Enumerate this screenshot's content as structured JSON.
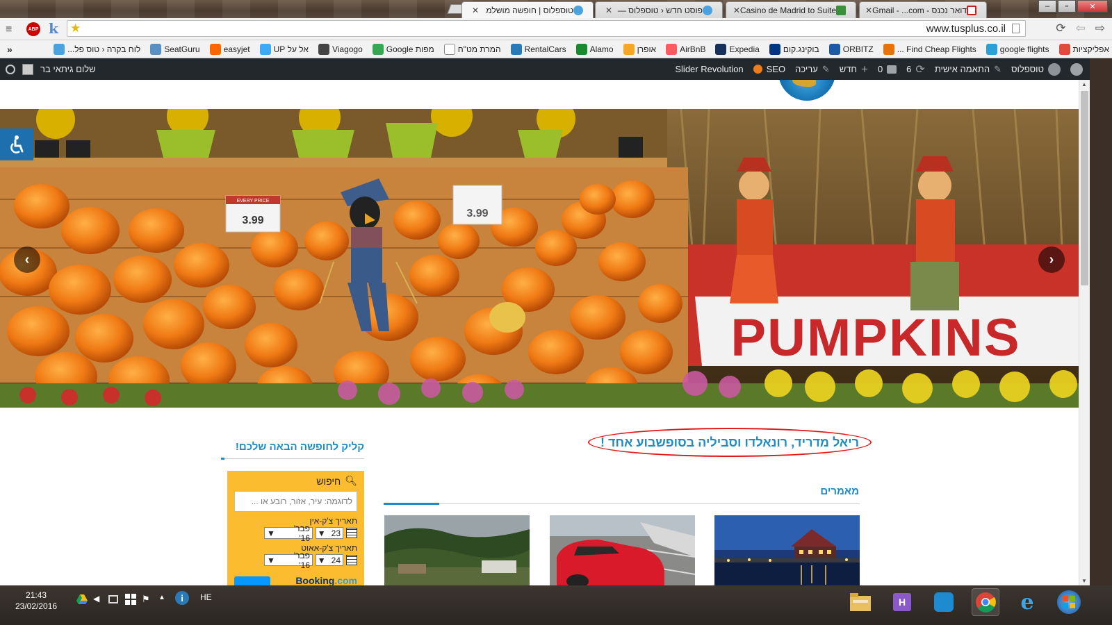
{
  "browser": {
    "tabs": [
      {
        "title": "דואר נכנס - Gmail - ...com",
        "favicon_color": "#c5221f"
      },
      {
        "title": "Casino de Madrid to Suite",
        "favicon_color": "#3a8f3a"
      },
      {
        "title": "פוסט חדש ‹ טוספלוס —",
        "favicon_color": "#4aa3df"
      },
      {
        "title": "טוספלוס | חופשה מושלמ",
        "favicon_color": "#4aa3df"
      }
    ],
    "url": "www.tusplus.co.il",
    "abp_label": "ABP",
    "k_label": "k",
    "window_buttons": {
      "minimize": "–",
      "maximize": "▫",
      "close": "✕"
    },
    "nav": {
      "reload": "⟳",
      "back": "⇦",
      "forward": "⇨"
    }
  },
  "bookmarks": [
    {
      "label": "אפליקציות",
      "color": "#e04b3a"
    },
    {
      "label": "google flights",
      "color": "#2a9fd8"
    },
    {
      "label": "Find Cheap Flights ...",
      "color": "#e8710a"
    },
    {
      "label": "ORBITZ",
      "color": "#1b5aa8"
    },
    {
      "label": "בוקינג.קום",
      "color": "#003580"
    },
    {
      "label": "Expedia",
      "color": "#16325c"
    },
    {
      "label": "AirBnB",
      "color": "#ff5a5f"
    },
    {
      "label": "אופרן",
      "color": "#f5a623"
    },
    {
      "label": "Alamo",
      "color": "#1a8a2e"
    },
    {
      "label": "RentalCars",
      "color": "#2a7ab8"
    },
    {
      "label": "המרת מט\"ח",
      "color": "#ffffff"
    },
    {
      "label": "מפות Google",
      "color": "#34a853"
    },
    {
      "label": "Viagogo",
      "color": "#444444"
    },
    {
      "label": "אל על UP",
      "color": "#3fa9f5"
    },
    {
      "label": "easyjet",
      "color": "#ff6600"
    },
    {
      "label": "SeatGuru",
      "color": "#5a8fc2"
    },
    {
      "label": "לוח בקרה ‹ טוס פל...",
      "color": "#4aa3df"
    }
  ],
  "wp_admin": {
    "site_name": "טוספלוס",
    "customize": "התאמה אישית",
    "updates_count": "6",
    "comments_count": "0",
    "new_label": "חדש",
    "edit_label": "עריכה",
    "seo_label": "SEO",
    "slider_label": "Slider Revolution",
    "greeting": "שלום גיתאי בר"
  },
  "page": {
    "headline": "ריאל מדריד, רונאלדו וסביליה בסופשבוע אחד !",
    "articles_title": "מאמרים",
    "sidebar_title": "קליק לחופשה הבאה שלכם!",
    "slider_sign": "PUMPKINS",
    "price_tag_1": "3.99",
    "price_tag_2": "3.99",
    "price_tag_header": "EVERY PRICE"
  },
  "booking": {
    "search_label": "חיפוש",
    "placeholder": "לדוגמה: עיר, אזור, רובע או ...",
    "checkin_label": "תאריך צ'ק-אין",
    "checkin_day": "23",
    "checkin_month": "פבר' 16'",
    "checkout_label": "תאריך צ'ק-אאוט",
    "checkout_day": "24",
    "checkout_month": "פבר' 16'",
    "logo_main": "Booking",
    "logo_suffix": ".com"
  },
  "taskbar": {
    "time": "21:43",
    "date": "23/02/2016",
    "lang": "HE"
  }
}
